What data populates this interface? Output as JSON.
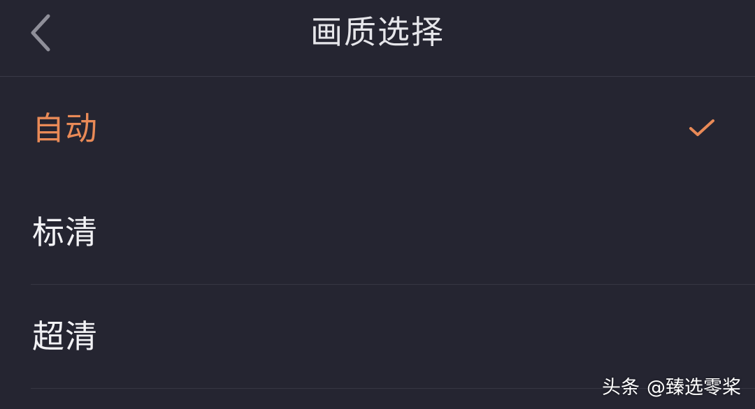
{
  "header": {
    "title": "画质选择",
    "back_icon": "chevron-left-icon"
  },
  "options": [
    {
      "label": "自动",
      "selected": true
    },
    {
      "label": "标清",
      "selected": false
    },
    {
      "label": "超清",
      "selected": false
    }
  ],
  "check_icon": "checkmark-icon",
  "colors": {
    "background": "#252531",
    "accent": "#e98a57",
    "text": "#f2f2f5"
  },
  "watermark": {
    "brand": "头条",
    "handle": "@臻选零桨"
  }
}
